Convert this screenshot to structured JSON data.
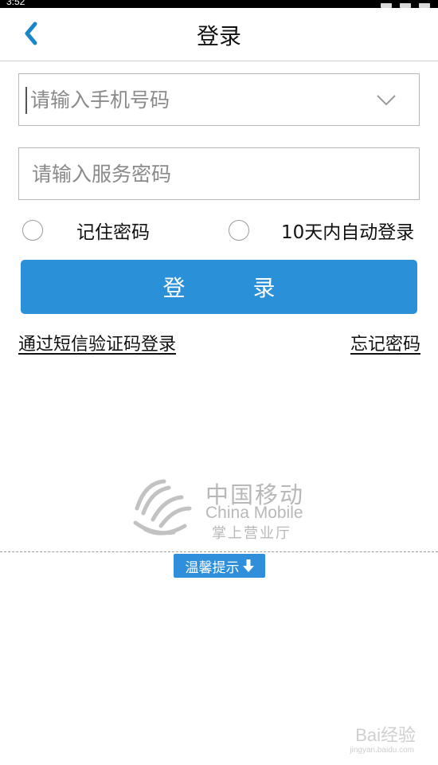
{
  "status_bar": {
    "time": "3:52"
  },
  "header": {
    "title": "登录",
    "back_icon": "chevron-left-icon"
  },
  "form": {
    "phone_placeholder": "请输入手机号码",
    "password_placeholder": "请输入服务密码",
    "dropdown_icon": "chevron-down-icon",
    "remember_label": "记住密码",
    "auto_login_label": "10天内自动登录",
    "login_button": "登 录",
    "sms_login_link": "通过短信验证码登录",
    "forgot_link": "忘记密码"
  },
  "brand": {
    "name_cn": "中国移动",
    "name_en": "China Mobile",
    "subtitle": "掌上营业厅"
  },
  "tip": {
    "label": "温馨提示",
    "icon": "arrow-down-icon"
  },
  "watermark": {
    "text": "Bai经验",
    "sub": "jingyan.baidu.com"
  },
  "colors": {
    "accent": "#2a90d8",
    "back_icon": "#1a86c8",
    "brand_gray": "#b8b8b8"
  }
}
